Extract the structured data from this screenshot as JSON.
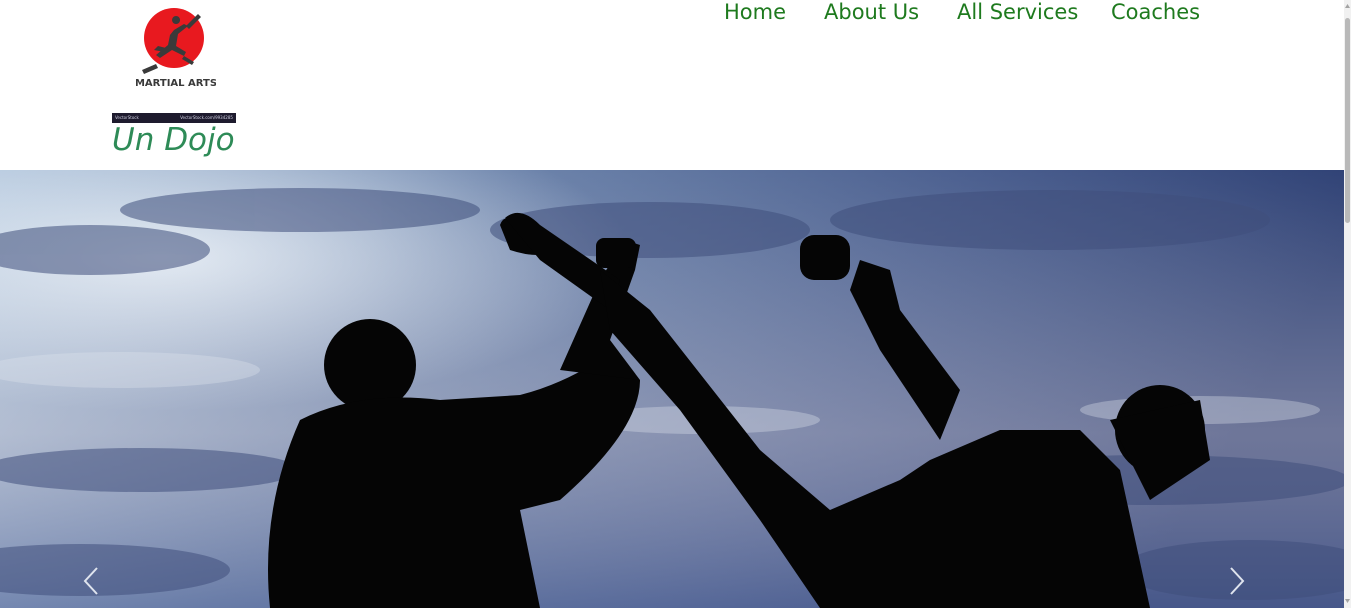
{
  "brand": {
    "logo_text": "MARTIAL ARTS",
    "stock_text": "VectorStock",
    "stock_id": "VectorStock.com/9934285",
    "title": "Un Dojo",
    "logo_circle_color": "#e8191f"
  },
  "nav": {
    "items": [
      {
        "label": "Home"
      },
      {
        "label": "About Us"
      },
      {
        "label": "All Services"
      },
      {
        "label": "Coaches"
      }
    ],
    "color": "#1e7a1e"
  },
  "hero": {
    "image": "martial-artists-silhouette-sky",
    "prev_icon": "chevron-left-icon",
    "next_icon": "chevron-right-icon"
  }
}
